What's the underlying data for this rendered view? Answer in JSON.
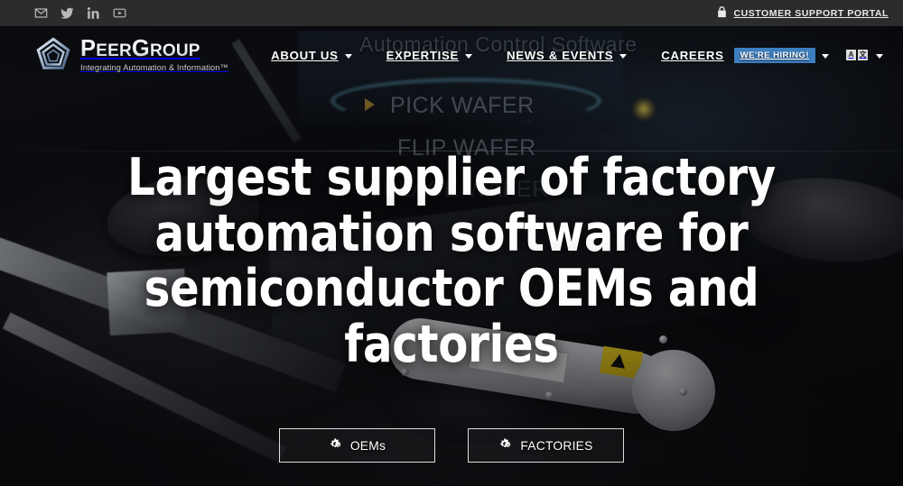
{
  "utility_bar": {
    "social_links": [
      {
        "name": "email-icon",
        "label": "Email"
      },
      {
        "name": "twitter-icon",
        "label": "Twitter"
      },
      {
        "name": "linkedin-icon",
        "label": "LinkedIn"
      },
      {
        "name": "youtube-icon",
        "label": "YouTube"
      }
    ],
    "support_portal_label": "CUSTOMER SUPPORT PORTAL",
    "support_portal_icon": "lock-icon",
    "background_color": "#2c2c2c"
  },
  "header": {
    "logo": {
      "mark_icon": "pentagon-logo-icon",
      "word_part1": "P",
      "word_part2": "EER",
      "word_part3": "G",
      "word_part4": "ROUP",
      "wordmark": "PeerGroup",
      "tagline": "Integrating Automation & Information™"
    },
    "nav": [
      {
        "label": "ABOUT US",
        "has_dropdown": true,
        "name": "nav-item-about-us"
      },
      {
        "label": "EXPERTISE",
        "has_dropdown": true,
        "name": "nav-item-expertise"
      },
      {
        "label": "NEWS & EVENTS",
        "has_dropdown": true,
        "name": "nav-item-news-events"
      },
      {
        "label": "CAREERS",
        "has_dropdown": true,
        "name": "nav-item-careers",
        "badge": "WE'RE HIRING!"
      }
    ],
    "language_switcher": {
      "icon": "language-translate-icon",
      "glyph_latin": "A",
      "glyph_cjk": "文",
      "caret_icon": "chevron-down-icon"
    },
    "accent_color": "#3d7ec0"
  },
  "hero": {
    "headline": "Largest supplier of factory automation software for semiconductor OEMs and factories",
    "buttons": [
      {
        "label": "OEMs",
        "icon": "cogs-icon",
        "name": "hero-button-oems"
      },
      {
        "label": "FACTORIES",
        "icon": "cogs-icon",
        "name": "hero-button-factories"
      }
    ],
    "background_video_captions": {
      "title": "Automation Control Software",
      "steps": [
        "PICK WAFER",
        "FLIP WAFER",
        "PLACE WAFER"
      ],
      "play_icon": "play-arrow-icon"
    },
    "overlay_color": "#05060 8"
  }
}
